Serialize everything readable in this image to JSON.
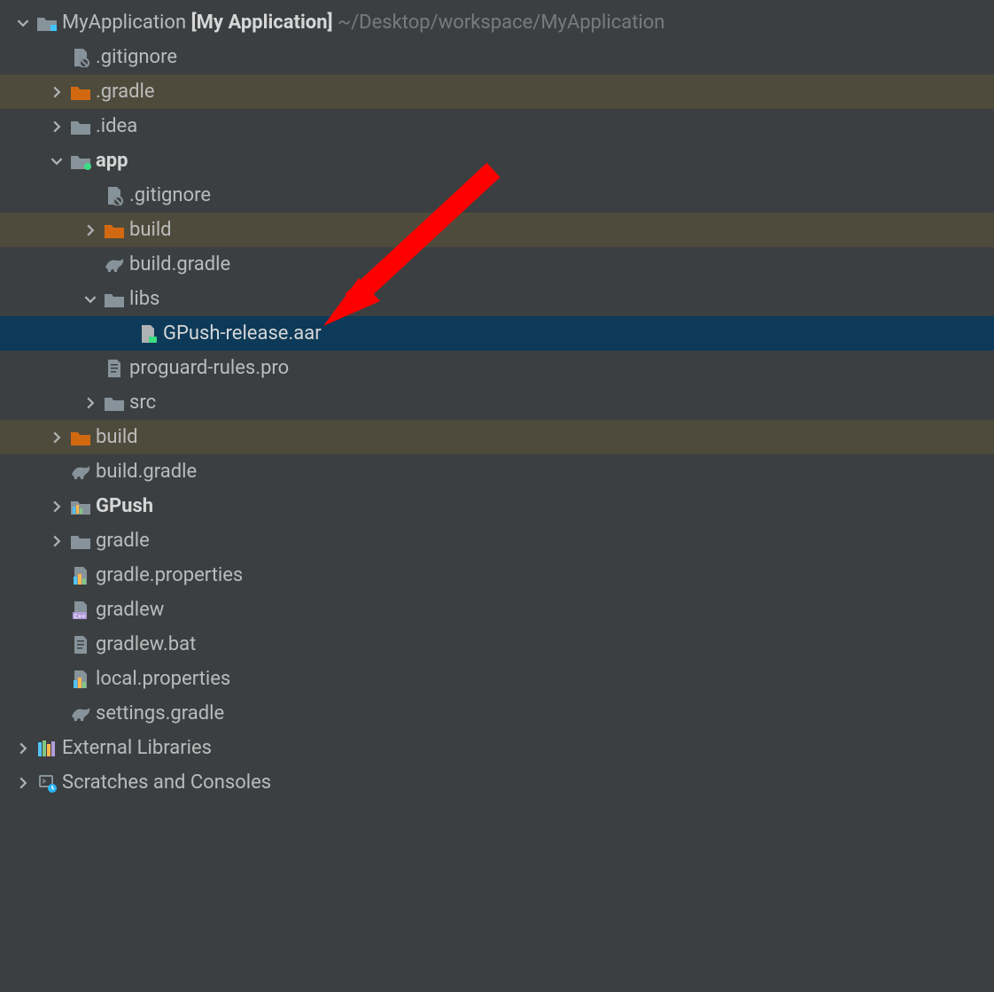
{
  "root": {
    "name": "MyApplication",
    "context": "[My Application]",
    "path": "~/Desktop/workspace/MyApplication"
  },
  "items": {
    "gitignore_root": ".gitignore",
    "gradle_hidden": ".gradle",
    "idea": ".idea",
    "app": "app",
    "app_gitignore": ".gitignore",
    "app_build": "build",
    "app_build_gradle": "build.gradle",
    "app_libs": "libs",
    "gpush_aar": "GPush-release.aar",
    "proguard": "proguard-rules.pro",
    "app_src": "src",
    "build": "build",
    "build_gradle": "build.gradle",
    "gpush_module": "GPush",
    "gradle_folder": "gradle",
    "gradle_properties": "gradle.properties",
    "gradlew": "gradlew",
    "gradlew_bat": "gradlew.bat",
    "local_properties": "local.properties",
    "settings_gradle": "settings.gradle",
    "external_libraries": "External Libraries",
    "scratches": "Scratches and Consoles"
  },
  "colors": {
    "folder_orange": "#D26911",
    "folder_grey": "#87939A",
    "selected_bg": "#0D3A58",
    "hl_bg": "#4E4B3C",
    "arrow_red": "#FF0000"
  }
}
